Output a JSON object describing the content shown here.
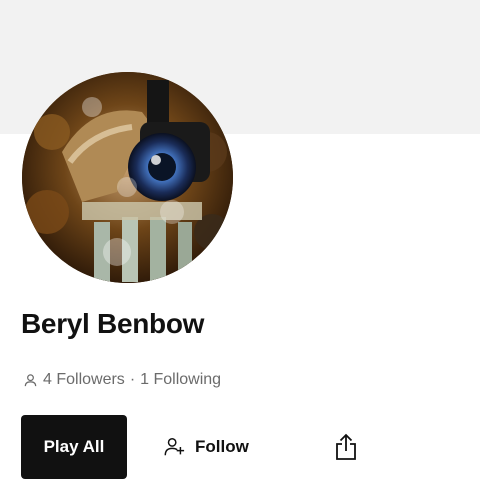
{
  "profile": {
    "name": "Beryl Benbow",
    "followers_label": "4 Followers",
    "separator": "·",
    "following_label": "1 Following"
  },
  "actions": {
    "play_all_label": "Play All",
    "follow_label": "Follow"
  },
  "icons": {
    "followers": "person-icon",
    "follow": "person-add-icon",
    "share": "share-icon"
  },
  "colors": {
    "banner": "#f2f2f2",
    "primary_button": "#111111",
    "muted_text": "#6b6b6b"
  }
}
